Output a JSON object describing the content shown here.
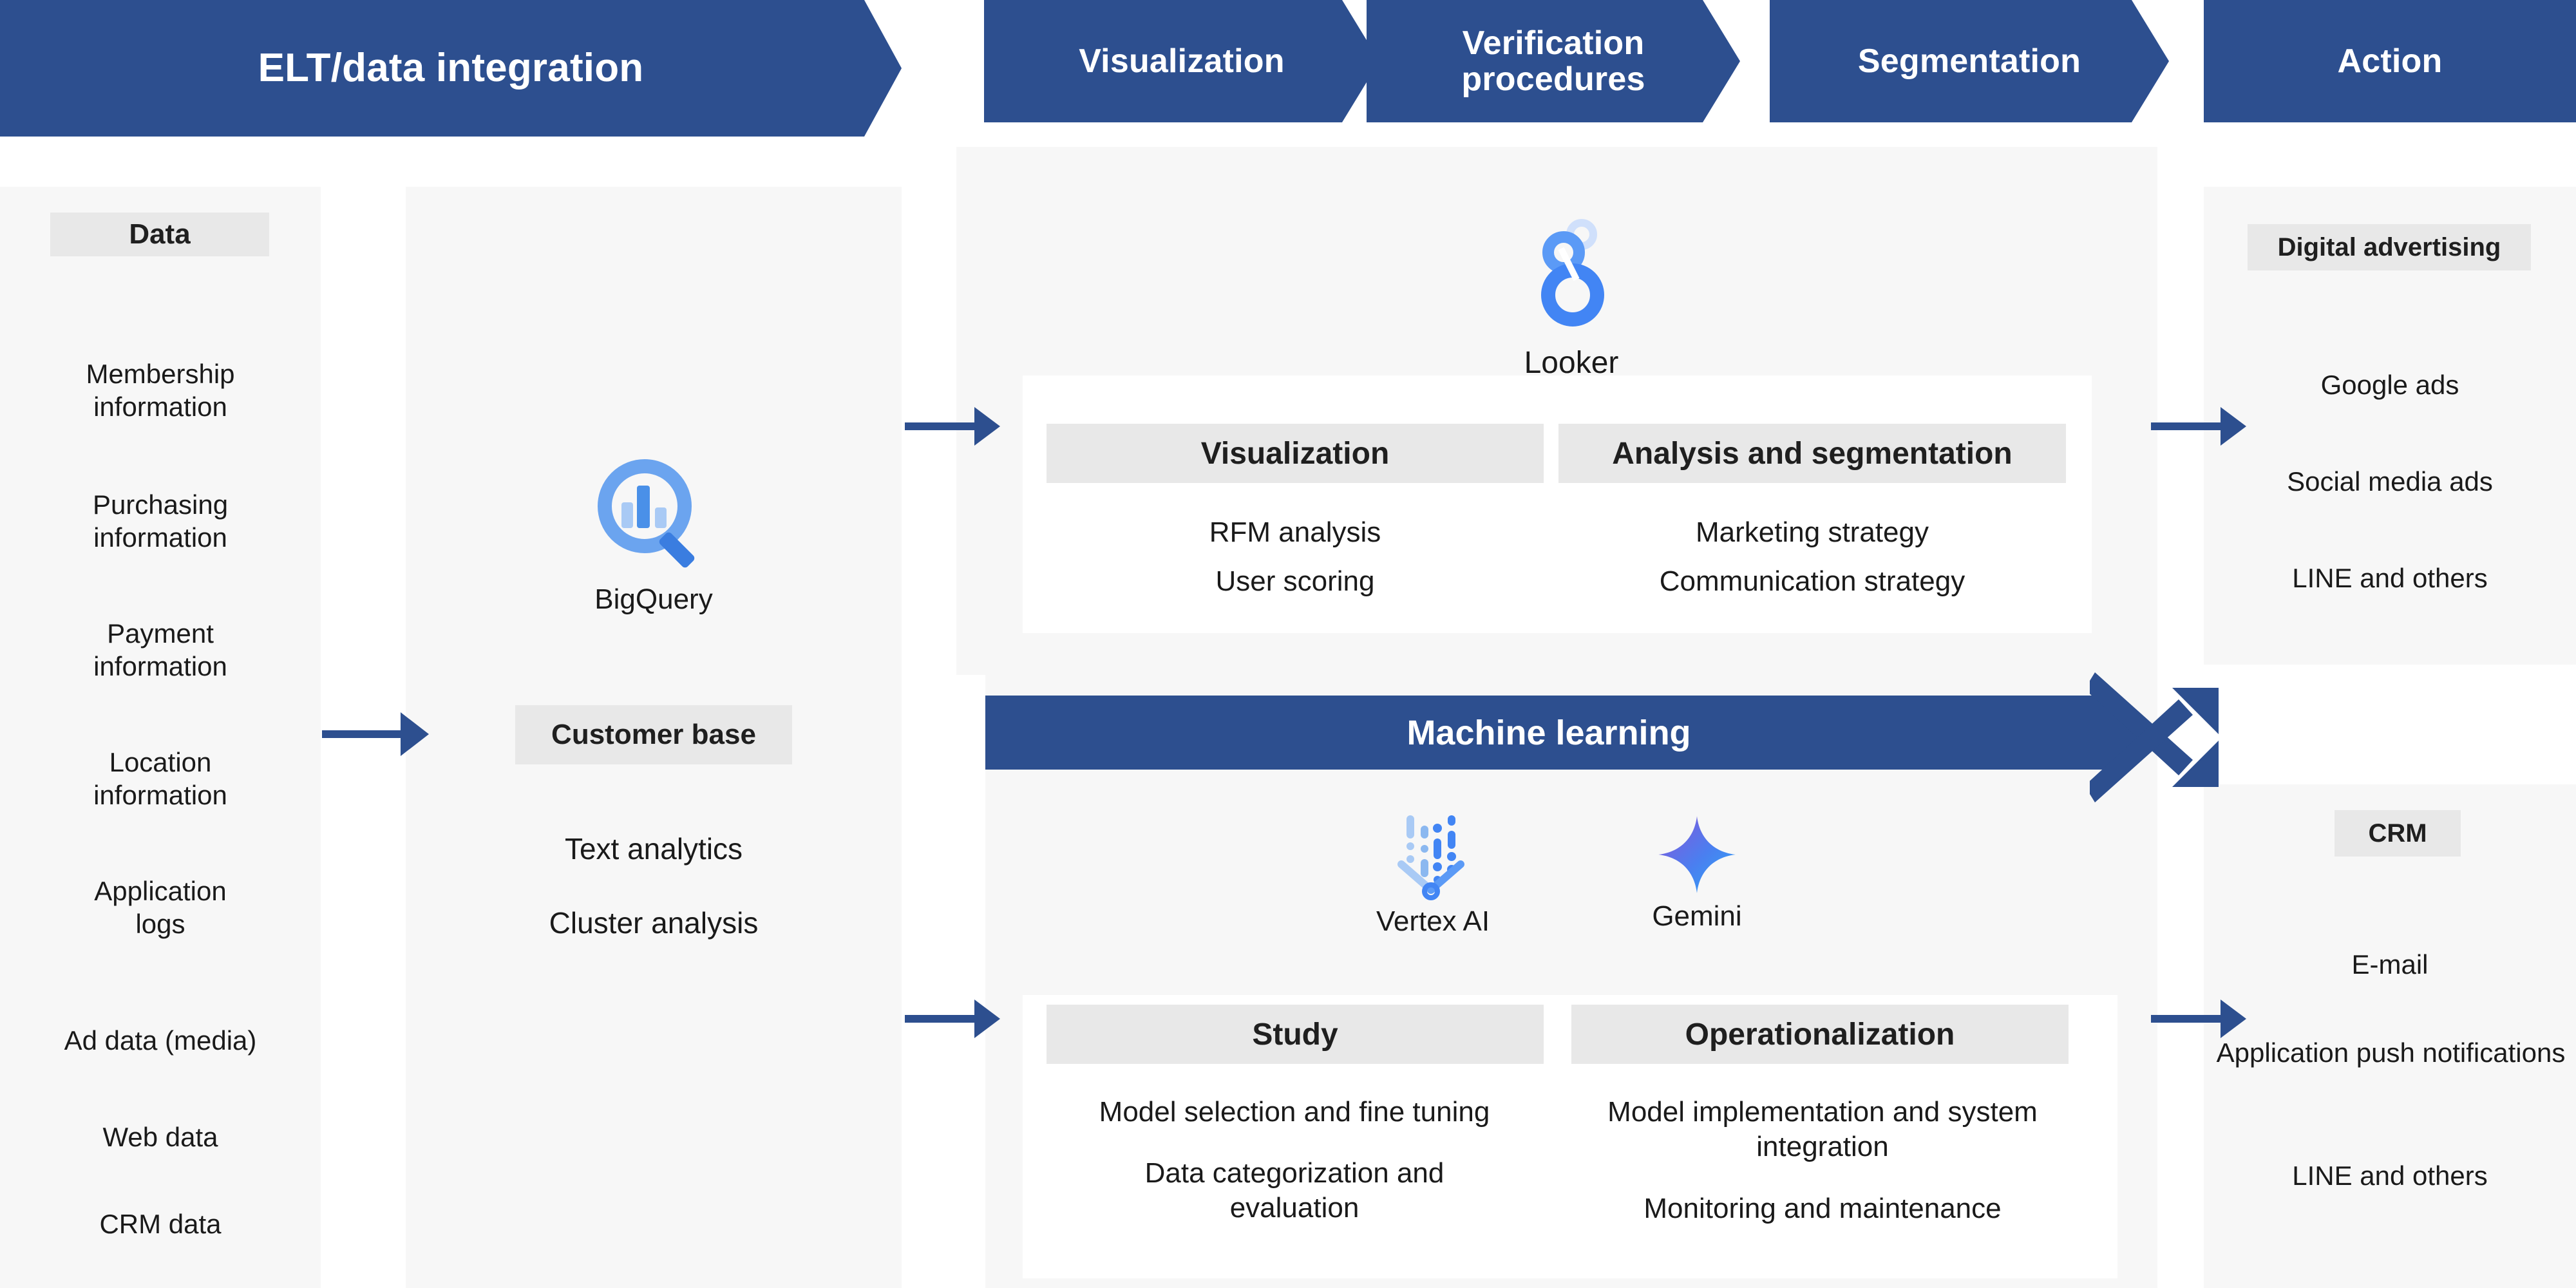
{
  "headers": [
    {
      "label": "ELT/data integration",
      "shape": "chevron"
    },
    {
      "label": "Visualization",
      "shape": "chevron"
    },
    {
      "label": "Verification\nprocedures",
      "line1": "Verification",
      "line2": "procedures",
      "shape": "chevron"
    },
    {
      "label": "Segmentation",
      "shape": "chevron"
    },
    {
      "label": "Action",
      "shape": "rectangle"
    }
  ],
  "colors": {
    "brand_blue": "#2d4f8f",
    "panel_gray": "#f7f7f7",
    "chip_gray": "#e8e8e8",
    "card_white": "#ffffff",
    "text_dark": "#1a1a1a",
    "bigquery_blue": "#4a90e8",
    "looker_blue": "#4285f4",
    "gemini_purple": "#7b5cd6",
    "gemini_blue": "#3d8bf2"
  },
  "data_column": {
    "chip": "Data",
    "items": [
      "Membership\ninformation",
      "Purchasing\ninformation",
      "Payment\ninformation",
      "Location\ninformation",
      "Application\nlogs",
      "Ad data (media)",
      "Web data",
      "CRM data"
    ]
  },
  "bigquery_column": {
    "logo_name": "bigquery-logo",
    "logo_caption": "BigQuery",
    "chip": "Customer base",
    "items": [
      "Text analytics",
      "Cluster analysis"
    ]
  },
  "looker_section": {
    "logo_name": "looker-logo",
    "logo_caption": "Looker",
    "boxes": [
      {
        "chip": "Visualization",
        "items": [
          "RFM analysis",
          "User scoring"
        ]
      },
      {
        "chip": "Analysis and segmentation",
        "items": [
          "Marketing strategy",
          "Communication strategy"
        ]
      }
    ]
  },
  "ml_section": {
    "banner": "Machine learning",
    "logos": [
      {
        "name": "vertex-ai-logo",
        "caption": "Vertex AI"
      },
      {
        "name": "gemini-logo",
        "caption": "Gemini"
      }
    ],
    "boxes": [
      {
        "chip": "Study",
        "items": [
          "Model selection and fine tuning",
          "Data categorization and evaluation"
        ]
      },
      {
        "chip": "Operationalization",
        "items": [
          "Model implementation and system integration",
          "Monitoring and maintenance"
        ]
      }
    ]
  },
  "action_column": {
    "groups": [
      {
        "chip": "Digital advertising",
        "items": [
          "Google ads",
          "Social media ads",
          "LINE and others"
        ]
      },
      {
        "chip": "CRM",
        "items": [
          "E-mail",
          "Application push notifications",
          "LINE and others"
        ]
      }
    ]
  },
  "connectors": {
    "data_to_bigquery": "arrow-right",
    "bigquery_to_looker": "arrow-right",
    "bigquery_to_ml": "arrow-right",
    "looker_to_digital_ads": "arrow-right",
    "ml_to_crm": "arrow-right",
    "crossing": "crossing-arrows"
  }
}
